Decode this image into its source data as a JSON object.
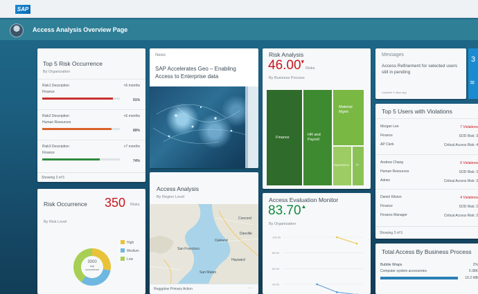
{
  "brand": {
    "logo_text": "SAP"
  },
  "shell": {
    "title": "Access Analysis Overview Page"
  },
  "risk_occurrence_top5": {
    "title": "Top 5 Risk Occurrence",
    "subtitle": "By Organization",
    "items": [
      {
        "desc": "Risk1 Description",
        "dept": "Finance",
        "period": "<6 months",
        "pct": "91%",
        "value": 0.91,
        "color": "#c8302f"
      },
      {
        "desc": "Risk2 Description",
        "dept": "Human Resources",
        "period": "<6 months",
        "pct": "89%",
        "value": 0.89,
        "color": "#d9622b"
      },
      {
        "desc": "Risk3 Description",
        "dept": "Finance",
        "period": ">7 months",
        "pct": "74%",
        "value": 0.74,
        "color": "#2e8a3e"
      }
    ],
    "footer": "Showing 3 of 5"
  },
  "news": {
    "label": "News",
    "headline": "SAP Accelerates Geo – Enabling Access to Enterprise data"
  },
  "risk_analysis": {
    "title": "Risk Analysis",
    "value": "46.00",
    "unit": "Risks",
    "subtitle": "By Business Process",
    "treemap": [
      {
        "label": "Finance",
        "color": "#2f6b2a"
      },
      {
        "label": "HR and Payroll",
        "color": "#3e8a30"
      },
      {
        "label": "Material Mgmt",
        "color": "#78b843"
      },
      {
        "label": "Operations",
        "color": "#9ccc63"
      },
      {
        "label": "IT",
        "color": "#8bc255"
      }
    ]
  },
  "messages": {
    "title": "Messages",
    "text": "Access Refinement for selected users still in pending",
    "time": "Updated 3 days ago",
    "side_count": "3"
  },
  "users_violations": {
    "title": "Top 5 Users with Violations",
    "users": [
      {
        "name": "Morgan Lee",
        "dept": "Finance",
        "role": "AP Clerk",
        "violations": "7 Violations",
        "sod": "SOD Risk: 3",
        "critical": "Critical Access Risk: 4"
      },
      {
        "name": "Andrew Chang",
        "dept": "Human Resources",
        "role": "Admin",
        "violations": "6 Violations",
        "sod": "SOD Risk: 3",
        "critical": "Critical Access Risk: 3"
      },
      {
        "name": "Daniel Kitsion",
        "dept": "Finance",
        "role": "Finance Manager",
        "violations": "4 Violations",
        "sod": "SOD Risk: 2",
        "critical": "Critical Access Risk: 2"
      }
    ],
    "footer": "Showing 3 of 5"
  },
  "risk_occurrence": {
    "title": "Risk Occurrence",
    "value": "350",
    "unit": "Risks",
    "subtitle": "By Risk Level",
    "donut_center": [
      "3000",
      "risk",
      "occurrence"
    ],
    "legend": [
      {
        "label": "High",
        "color": "#e8c33a",
        "value": 0.28
      },
      {
        "label": "Medium",
        "color": "#6fb7e0",
        "value": 0.32
      },
      {
        "label": "Low",
        "color": "#a8cf55",
        "value": 0.4
      }
    ]
  },
  "access_analysis": {
    "title": "Access Analysis",
    "subtitle": "By Region Level",
    "map_labels": [
      "San Francisco",
      "Oakland",
      "Concord",
      "San Mateo",
      "Hayward",
      "Danville"
    ],
    "footer": "Reggplow Primary Action"
  },
  "access_monitor": {
    "title": "Access Evaluation Monitor",
    "value": "83.70",
    "subtitle": "By Organization",
    "y_ticks": [
      "100.00",
      "80.00",
      "60.00",
      "40.00"
    ],
    "chart_data": {
      "type": "line",
      "y_ticks": [
        100,
        80,
        60,
        40
      ],
      "series": [
        {
          "values": [
            null,
            null,
            100,
            92
          ],
          "color": "#e7c94a"
        },
        {
          "values": [
            null,
            40,
            30,
            27
          ],
          "color": "#5a9bd8"
        }
      ]
    }
  },
  "business_process": {
    "title": "Total Access By Business Process",
    "item_label": "Bubble Wraps",
    "item_sub": "Computer system accessories",
    "item_values": [
      "2%",
      "0.38K",
      "10.2 MB"
    ]
  }
}
